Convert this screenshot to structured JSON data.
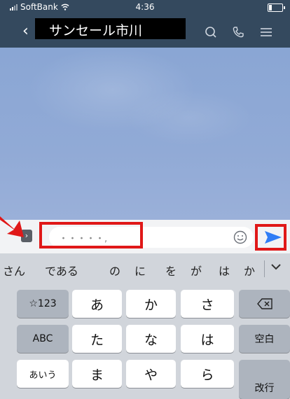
{
  "status": {
    "carrier": "SoftBank",
    "time": "4:36"
  },
  "header": {
    "back": "‹",
    "title": "サンセール市川",
    "icons": [
      "search-icon",
      "phone-icon",
      "menu-icon"
    ]
  },
  "composer": {
    "expand": "›",
    "input_value": "・・・・・,",
    "input_placeholder": ""
  },
  "colors": {
    "header": "#34495e",
    "send": "#2f7df6",
    "highlight": "#e01818"
  },
  "suggestions": [
    "さん",
    "である",
    "の",
    "に",
    "を",
    "が",
    "は",
    "か"
  ],
  "keyboard": {
    "row1": [
      "☆123",
      "あ",
      "か",
      "さ",
      "⌫"
    ],
    "row2": [
      "ABC",
      "た",
      "な",
      "は",
      "空白"
    ],
    "row3": [
      "あいう",
      "ま",
      "や",
      "ら",
      "改行"
    ]
  }
}
